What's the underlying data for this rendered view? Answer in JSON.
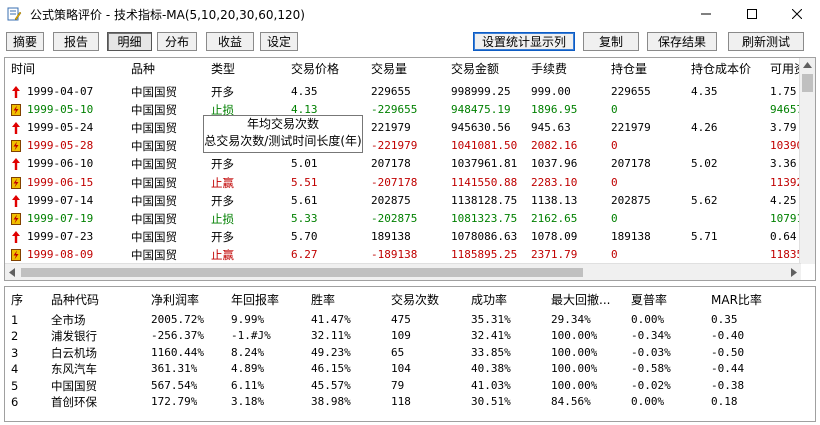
{
  "window": {
    "title": "公式策略评价 - 技术指标-MA(5,10,20,30,60,120)",
    "minimize_icon": "minimize-icon",
    "maximize_icon": "maximize-icon",
    "close_icon": "close-icon"
  },
  "toolbar": {
    "tabs": [
      "摘要",
      "报告",
      "明细",
      "分布",
      "收益",
      "设定"
    ],
    "active_tab": "明细",
    "buttons": [
      "设置统计显示列",
      "复制",
      "保存结果",
      "刷新测试"
    ]
  },
  "detail_table": {
    "columns": [
      "时间",
      "品种",
      "类型",
      "交易价格",
      "交易量",
      "交易金额",
      "手续费",
      "持仓量",
      "持仓成本价",
      "可用资"
    ],
    "rows": [
      {
        "icon": "up-arrow-icon",
        "color": "black",
        "cells": [
          "1999-04-07",
          "中国国贸",
          "开多",
          "4.35",
          "229655",
          "998999.25",
          "999.00",
          "229655",
          "4.35",
          "1.75"
        ]
      },
      {
        "icon": "lightning-icon",
        "color": "green",
        "cells": [
          "1999-05-10",
          "中国国贸",
          "止损",
          "4.13",
          "-229655",
          "948475.19",
          "1896.95",
          "0",
          "",
          "94657"
        ]
      },
      {
        "icon": "up-arrow-icon",
        "color": "black",
        "cells": [
          "1999-05-24",
          "中国国贸",
          "开多",
          "",
          "221979",
          "945630.56",
          "945.63",
          "221979",
          "4.26",
          "3.79"
        ]
      },
      {
        "icon": "lightning-icon",
        "color": "red",
        "cells": [
          "1999-05-28",
          "中国国贸",
          "",
          "",
          "-221979",
          "1041081.50",
          "2082.16",
          "0",
          "",
          "10390"
        ]
      },
      {
        "icon": "up-arrow-icon",
        "color": "black",
        "cells": [
          "1999-06-10",
          "中国国贸",
          "开多",
          "5.01",
          "207178",
          "1037961.81",
          "1037.96",
          "207178",
          "5.02",
          "3.36"
        ]
      },
      {
        "icon": "lightning-icon",
        "color": "red",
        "cells": [
          "1999-06-15",
          "中国国贸",
          "止赢",
          "5.51",
          "-207178",
          "1141550.88",
          "2283.10",
          "0",
          "",
          "11392"
        ]
      },
      {
        "icon": "up-arrow-icon",
        "color": "black",
        "cells": [
          "1999-07-14",
          "中国国贸",
          "开多",
          "5.61",
          "202875",
          "1138128.75",
          "1138.13",
          "202875",
          "5.62",
          "4.25"
        ]
      },
      {
        "icon": "lightning-icon",
        "color": "green",
        "cells": [
          "1999-07-19",
          "中国国贸",
          "止损",
          "5.33",
          "-202875",
          "1081323.75",
          "2162.65",
          "0",
          "",
          "10791"
        ]
      },
      {
        "icon": "up-arrow-icon",
        "color": "black",
        "cells": [
          "1999-07-23",
          "中国国贸",
          "开多",
          "5.70",
          "189138",
          "1078086.63",
          "1078.09",
          "189138",
          "5.71",
          "0.64"
        ]
      },
      {
        "icon": "lightning-icon",
        "color": "red",
        "cells": [
          "1999-08-09",
          "中国国贸",
          "止赢",
          "6.27",
          "-189138",
          "1185895.25",
          "2371.79",
          "0",
          "",
          "11835"
        ]
      }
    ]
  },
  "tooltip": {
    "line1": "年均交易次数",
    "line2": "总交易次数/测试时间长度(年)"
  },
  "summary_table": {
    "columns": [
      "序",
      "品种代码",
      "净利润率",
      "年回报率",
      "胜率",
      "交易次数",
      "成功率",
      "最大回撤...",
      "夏普率",
      "MAR比率"
    ],
    "rows": [
      [
        "1",
        "全市场",
        "2005.72%",
        "9.99%",
        "41.47%",
        "475",
        "35.31%",
        "29.34%",
        "0.00%",
        "0.35"
      ],
      [
        "2",
        "浦发银行",
        "-256.37%",
        "-1.#J%",
        "32.11%",
        "109",
        "32.41%",
        "100.00%",
        "-0.34%",
        "-0.40"
      ],
      [
        "3",
        "白云机场",
        "1160.44%",
        "8.24%",
        "49.23%",
        "65",
        "33.85%",
        "100.00%",
        "-0.03%",
        "-0.50"
      ],
      [
        "4",
        "东风汽车",
        "361.31%",
        "4.89%",
        "46.15%",
        "104",
        "40.38%",
        "100.00%",
        "-0.58%",
        "-0.44"
      ],
      [
        "5",
        "中国国贸",
        "567.54%",
        "6.11%",
        "45.57%",
        "79",
        "41.03%",
        "100.00%",
        "-0.02%",
        "-0.38"
      ],
      [
        "6",
        "首创环保",
        "172.79%",
        "3.18%",
        "38.98%",
        "118",
        "30.51%",
        "84.56%",
        "0.00%",
        "0.18"
      ]
    ]
  },
  "colors": {
    "green": "#008000",
    "red": "#c00000",
    "up_arrow": "#e00000",
    "lightning_bg": "#f0c000"
  }
}
